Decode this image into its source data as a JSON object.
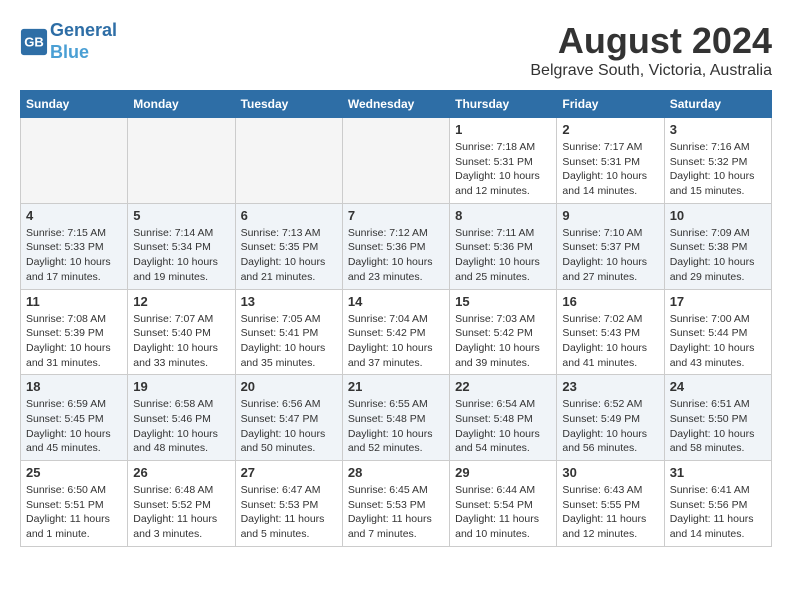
{
  "header": {
    "logo_line1": "General",
    "logo_line2": "Blue",
    "month_year": "August 2024",
    "location": "Belgrave South, Victoria, Australia"
  },
  "days_of_week": [
    "Sunday",
    "Monday",
    "Tuesday",
    "Wednesday",
    "Thursday",
    "Friday",
    "Saturday"
  ],
  "weeks": [
    [
      {
        "day": "",
        "info": ""
      },
      {
        "day": "",
        "info": ""
      },
      {
        "day": "",
        "info": ""
      },
      {
        "day": "",
        "info": ""
      },
      {
        "day": "1",
        "info": "Sunrise: 7:18 AM\nSunset: 5:31 PM\nDaylight: 10 hours\nand 12 minutes."
      },
      {
        "day": "2",
        "info": "Sunrise: 7:17 AM\nSunset: 5:31 PM\nDaylight: 10 hours\nand 14 minutes."
      },
      {
        "day": "3",
        "info": "Sunrise: 7:16 AM\nSunset: 5:32 PM\nDaylight: 10 hours\nand 15 minutes."
      }
    ],
    [
      {
        "day": "4",
        "info": "Sunrise: 7:15 AM\nSunset: 5:33 PM\nDaylight: 10 hours\nand 17 minutes."
      },
      {
        "day": "5",
        "info": "Sunrise: 7:14 AM\nSunset: 5:34 PM\nDaylight: 10 hours\nand 19 minutes."
      },
      {
        "day": "6",
        "info": "Sunrise: 7:13 AM\nSunset: 5:35 PM\nDaylight: 10 hours\nand 21 minutes."
      },
      {
        "day": "7",
        "info": "Sunrise: 7:12 AM\nSunset: 5:36 PM\nDaylight: 10 hours\nand 23 minutes."
      },
      {
        "day": "8",
        "info": "Sunrise: 7:11 AM\nSunset: 5:36 PM\nDaylight: 10 hours\nand 25 minutes."
      },
      {
        "day": "9",
        "info": "Sunrise: 7:10 AM\nSunset: 5:37 PM\nDaylight: 10 hours\nand 27 minutes."
      },
      {
        "day": "10",
        "info": "Sunrise: 7:09 AM\nSunset: 5:38 PM\nDaylight: 10 hours\nand 29 minutes."
      }
    ],
    [
      {
        "day": "11",
        "info": "Sunrise: 7:08 AM\nSunset: 5:39 PM\nDaylight: 10 hours\nand 31 minutes."
      },
      {
        "day": "12",
        "info": "Sunrise: 7:07 AM\nSunset: 5:40 PM\nDaylight: 10 hours\nand 33 minutes."
      },
      {
        "day": "13",
        "info": "Sunrise: 7:05 AM\nSunset: 5:41 PM\nDaylight: 10 hours\nand 35 minutes."
      },
      {
        "day": "14",
        "info": "Sunrise: 7:04 AM\nSunset: 5:42 PM\nDaylight: 10 hours\nand 37 minutes."
      },
      {
        "day": "15",
        "info": "Sunrise: 7:03 AM\nSunset: 5:42 PM\nDaylight: 10 hours\nand 39 minutes."
      },
      {
        "day": "16",
        "info": "Sunrise: 7:02 AM\nSunset: 5:43 PM\nDaylight: 10 hours\nand 41 minutes."
      },
      {
        "day": "17",
        "info": "Sunrise: 7:00 AM\nSunset: 5:44 PM\nDaylight: 10 hours\nand 43 minutes."
      }
    ],
    [
      {
        "day": "18",
        "info": "Sunrise: 6:59 AM\nSunset: 5:45 PM\nDaylight: 10 hours\nand 45 minutes."
      },
      {
        "day": "19",
        "info": "Sunrise: 6:58 AM\nSunset: 5:46 PM\nDaylight: 10 hours\nand 48 minutes."
      },
      {
        "day": "20",
        "info": "Sunrise: 6:56 AM\nSunset: 5:47 PM\nDaylight: 10 hours\nand 50 minutes."
      },
      {
        "day": "21",
        "info": "Sunrise: 6:55 AM\nSunset: 5:48 PM\nDaylight: 10 hours\nand 52 minutes."
      },
      {
        "day": "22",
        "info": "Sunrise: 6:54 AM\nSunset: 5:48 PM\nDaylight: 10 hours\nand 54 minutes."
      },
      {
        "day": "23",
        "info": "Sunrise: 6:52 AM\nSunset: 5:49 PM\nDaylight: 10 hours\nand 56 minutes."
      },
      {
        "day": "24",
        "info": "Sunrise: 6:51 AM\nSunset: 5:50 PM\nDaylight: 10 hours\nand 58 minutes."
      }
    ],
    [
      {
        "day": "25",
        "info": "Sunrise: 6:50 AM\nSunset: 5:51 PM\nDaylight: 11 hours\nand 1 minute."
      },
      {
        "day": "26",
        "info": "Sunrise: 6:48 AM\nSunset: 5:52 PM\nDaylight: 11 hours\nand 3 minutes."
      },
      {
        "day": "27",
        "info": "Sunrise: 6:47 AM\nSunset: 5:53 PM\nDaylight: 11 hours\nand 5 minutes."
      },
      {
        "day": "28",
        "info": "Sunrise: 6:45 AM\nSunset: 5:53 PM\nDaylight: 11 hours\nand 7 minutes."
      },
      {
        "day": "29",
        "info": "Sunrise: 6:44 AM\nSunset: 5:54 PM\nDaylight: 11 hours\nand 10 minutes."
      },
      {
        "day": "30",
        "info": "Sunrise: 6:43 AM\nSunset: 5:55 PM\nDaylight: 11 hours\nand 12 minutes."
      },
      {
        "day": "31",
        "info": "Sunrise: 6:41 AM\nSunset: 5:56 PM\nDaylight: 11 hours\nand 14 minutes."
      }
    ]
  ]
}
